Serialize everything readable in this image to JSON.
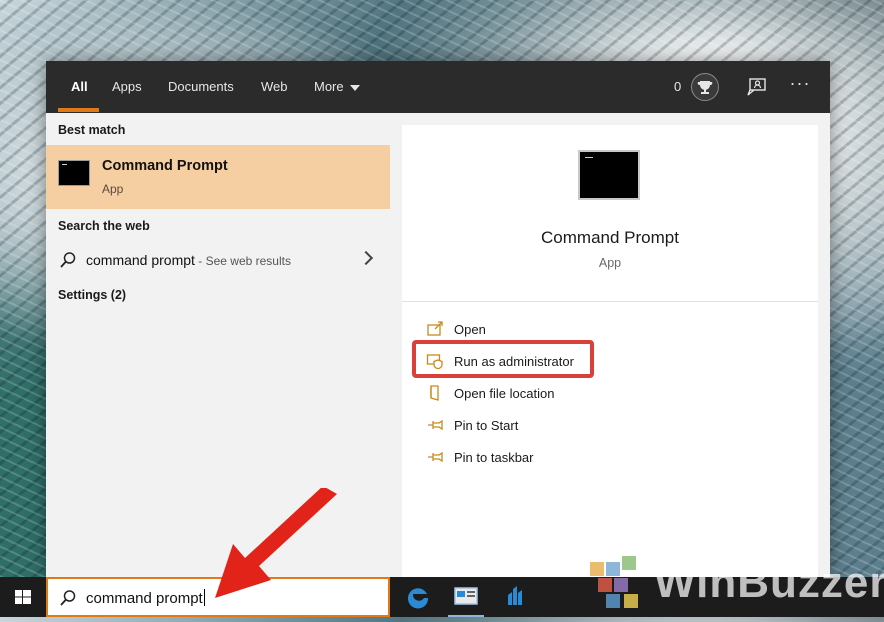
{
  "tabs": [
    {
      "label": "All",
      "active": true
    },
    {
      "label": "Apps"
    },
    {
      "label": "Documents"
    },
    {
      "label": "Web"
    },
    {
      "label": "More"
    }
  ],
  "header": {
    "reward_count": "0",
    "more_icon": "ellipsis-icon",
    "feedback_icon": "feedback-icon",
    "trophy_icon": "trophy-icon"
  },
  "results": {
    "best_match_label": "Best match",
    "best_match": {
      "title": "Command Prompt",
      "subtitle": "App",
      "icon": "cmd-icon"
    },
    "search_web_label": "Search the web",
    "web_result": {
      "query": "command prompt",
      "suffix": " - See web results"
    },
    "settings_label": "Settings (2)"
  },
  "detail": {
    "title": "Command Prompt",
    "subtitle": "App",
    "actions": [
      {
        "label": "Open",
        "icon": "open-icon"
      },
      {
        "label": "Run as administrator",
        "icon": "shield-icon",
        "highlighted": true
      },
      {
        "label": "Open file location",
        "icon": "file-location-icon"
      },
      {
        "label": "Pin to Start",
        "icon": "pin-icon"
      },
      {
        "label": "Pin to taskbar",
        "icon": "pin-icon"
      }
    ]
  },
  "search": {
    "value": "command prompt"
  },
  "watermark": {
    "text": "WinBuzzer"
  },
  "colors": {
    "accent": "#e07a17",
    "highlight": "#f5cfa2",
    "annotation": "#d9403a",
    "tab_bar": "#2b2b2b"
  }
}
